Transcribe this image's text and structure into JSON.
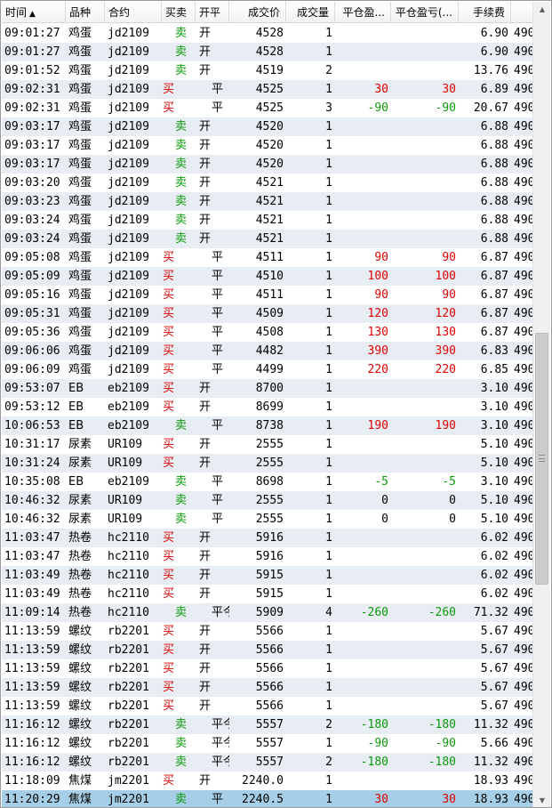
{
  "columns": {
    "time": "时间",
    "time_sort": "▲",
    "product": "品种",
    "contract": "合约",
    "side": "买卖",
    "open_close": "开平",
    "price": "成交价",
    "qty": "成交量",
    "close_pnl": "平仓盈...",
    "close_pnl2": "平仓盈亏(...",
    "fee": "手续费"
  },
  "rows": [
    {
      "time": "09:01:27",
      "product": "鸡蛋",
      "contract": "jd2109",
      "side": "卖",
      "oc": "开",
      "price": "4528",
      "qty": "1",
      "pnl1": "",
      "pnl2": "",
      "fee": "6.90",
      "ext": "490"
    },
    {
      "time": "09:01:27",
      "product": "鸡蛋",
      "contract": "jd2109",
      "side": "卖",
      "oc": "开",
      "price": "4528",
      "qty": "1",
      "pnl1": "",
      "pnl2": "",
      "fee": "6.90",
      "ext": "490"
    },
    {
      "time": "09:01:52",
      "product": "鸡蛋",
      "contract": "jd2109",
      "side": "卖",
      "oc": "开",
      "price": "4519",
      "qty": "2",
      "pnl1": "",
      "pnl2": "",
      "fee": "13.76",
      "ext": "490"
    },
    {
      "time": "09:02:31",
      "product": "鸡蛋",
      "contract": "jd2109",
      "side": "买",
      "oc": "平",
      "price": "4525",
      "qty": "1",
      "pnl1": "30",
      "pnl2": "30",
      "fee": "6.89",
      "ext": "490"
    },
    {
      "time": "09:02:31",
      "product": "鸡蛋",
      "contract": "jd2109",
      "side": "买",
      "oc": "平",
      "price": "4525",
      "qty": "3",
      "pnl1": "-90",
      "pnl2": "-90",
      "fee": "20.67",
      "ext": "490"
    },
    {
      "time": "09:03:17",
      "product": "鸡蛋",
      "contract": "jd2109",
      "side": "卖",
      "oc": "开",
      "price": "4520",
      "qty": "1",
      "pnl1": "",
      "pnl2": "",
      "fee": "6.88",
      "ext": "490"
    },
    {
      "time": "09:03:17",
      "product": "鸡蛋",
      "contract": "jd2109",
      "side": "卖",
      "oc": "开",
      "price": "4520",
      "qty": "1",
      "pnl1": "",
      "pnl2": "",
      "fee": "6.88",
      "ext": "490"
    },
    {
      "time": "09:03:17",
      "product": "鸡蛋",
      "contract": "jd2109",
      "side": "卖",
      "oc": "开",
      "price": "4520",
      "qty": "1",
      "pnl1": "",
      "pnl2": "",
      "fee": "6.88",
      "ext": "490"
    },
    {
      "time": "09:03:20",
      "product": "鸡蛋",
      "contract": "jd2109",
      "side": "卖",
      "oc": "开",
      "price": "4521",
      "qty": "1",
      "pnl1": "",
      "pnl2": "",
      "fee": "6.88",
      "ext": "490"
    },
    {
      "time": "09:03:23",
      "product": "鸡蛋",
      "contract": "jd2109",
      "side": "卖",
      "oc": "开",
      "price": "4521",
      "qty": "1",
      "pnl1": "",
      "pnl2": "",
      "fee": "6.88",
      "ext": "490"
    },
    {
      "time": "09:03:24",
      "product": "鸡蛋",
      "contract": "jd2109",
      "side": "卖",
      "oc": "开",
      "price": "4521",
      "qty": "1",
      "pnl1": "",
      "pnl2": "",
      "fee": "6.88",
      "ext": "490"
    },
    {
      "time": "09:03:24",
      "product": "鸡蛋",
      "contract": "jd2109",
      "side": "卖",
      "oc": "开",
      "price": "4521",
      "qty": "1",
      "pnl1": "",
      "pnl2": "",
      "fee": "6.88",
      "ext": "490"
    },
    {
      "time": "09:05:08",
      "product": "鸡蛋",
      "contract": "jd2109",
      "side": "买",
      "oc": "平",
      "price": "4511",
      "qty": "1",
      "pnl1": "90",
      "pnl2": "90",
      "fee": "6.87",
      "ext": "490"
    },
    {
      "time": "09:05:09",
      "product": "鸡蛋",
      "contract": "jd2109",
      "side": "买",
      "oc": "平",
      "price": "4510",
      "qty": "1",
      "pnl1": "100",
      "pnl2": "100",
      "fee": "6.87",
      "ext": "490"
    },
    {
      "time": "09:05:16",
      "product": "鸡蛋",
      "contract": "jd2109",
      "side": "买",
      "oc": "平",
      "price": "4511",
      "qty": "1",
      "pnl1": "90",
      "pnl2": "90",
      "fee": "6.87",
      "ext": "490"
    },
    {
      "time": "09:05:31",
      "product": "鸡蛋",
      "contract": "jd2109",
      "side": "买",
      "oc": "平",
      "price": "4509",
      "qty": "1",
      "pnl1": "120",
      "pnl2": "120",
      "fee": "6.87",
      "ext": "490"
    },
    {
      "time": "09:05:36",
      "product": "鸡蛋",
      "contract": "jd2109",
      "side": "买",
      "oc": "平",
      "price": "4508",
      "qty": "1",
      "pnl1": "130",
      "pnl2": "130",
      "fee": "6.87",
      "ext": "490"
    },
    {
      "time": "09:06:06",
      "product": "鸡蛋",
      "contract": "jd2109",
      "side": "买",
      "oc": "平",
      "price": "4482",
      "qty": "1",
      "pnl1": "390",
      "pnl2": "390",
      "fee": "6.83",
      "ext": "490"
    },
    {
      "time": "09:06:09",
      "product": "鸡蛋",
      "contract": "jd2109",
      "side": "买",
      "oc": "平",
      "price": "4499",
      "qty": "1",
      "pnl1": "220",
      "pnl2": "220",
      "fee": "6.85",
      "ext": "490"
    },
    {
      "time": "09:53:07",
      "product": "EB",
      "contract": "eb2109",
      "side": "买",
      "oc": "开",
      "price": "8700",
      "qty": "1",
      "pnl1": "",
      "pnl2": "",
      "fee": "3.10",
      "ext": "490"
    },
    {
      "time": "09:53:12",
      "product": "EB",
      "contract": "eb2109",
      "side": "买",
      "oc": "开",
      "price": "8699",
      "qty": "1",
      "pnl1": "",
      "pnl2": "",
      "fee": "3.10",
      "ext": "490"
    },
    {
      "time": "10:06:53",
      "product": "EB",
      "contract": "eb2109",
      "side": "卖",
      "oc": "平",
      "price": "8738",
      "qty": "1",
      "pnl1": "190",
      "pnl2": "190",
      "fee": "3.10",
      "ext": "490"
    },
    {
      "time": "10:31:17",
      "product": "尿素",
      "contract": "UR109",
      "side": "买",
      "oc": "开",
      "price": "2555",
      "qty": "1",
      "pnl1": "",
      "pnl2": "",
      "fee": "5.10",
      "ext": "490"
    },
    {
      "time": "10:31:24",
      "product": "尿素",
      "contract": "UR109",
      "side": "买",
      "oc": "开",
      "price": "2555",
      "qty": "1",
      "pnl1": "",
      "pnl2": "",
      "fee": "5.10",
      "ext": "490"
    },
    {
      "time": "10:35:08",
      "product": "EB",
      "contract": "eb2109",
      "side": "卖",
      "oc": "平",
      "price": "8698",
      "qty": "1",
      "pnl1": "-5",
      "pnl2": "-5",
      "fee": "3.10",
      "ext": "490"
    },
    {
      "time": "10:46:32",
      "product": "尿素",
      "contract": "UR109",
      "side": "卖",
      "oc": "平",
      "price": "2555",
      "qty": "1",
      "pnl1": "0",
      "pnl2": "0",
      "fee": "5.10",
      "ext": "490"
    },
    {
      "time": "10:46:32",
      "product": "尿素",
      "contract": "UR109",
      "side": "卖",
      "oc": "平",
      "price": "2555",
      "qty": "1",
      "pnl1": "0",
      "pnl2": "0",
      "fee": "5.10",
      "ext": "490"
    },
    {
      "time": "11:03:47",
      "product": "热卷",
      "contract": "hc2110",
      "side": "买",
      "oc": "开",
      "price": "5916",
      "qty": "1",
      "pnl1": "",
      "pnl2": "",
      "fee": "6.02",
      "ext": "490"
    },
    {
      "time": "11:03:47",
      "product": "热卷",
      "contract": "hc2110",
      "side": "买",
      "oc": "开",
      "price": "5916",
      "qty": "1",
      "pnl1": "",
      "pnl2": "",
      "fee": "6.02",
      "ext": "490"
    },
    {
      "time": "11:03:49",
      "product": "热卷",
      "contract": "hc2110",
      "side": "买",
      "oc": "开",
      "price": "5915",
      "qty": "1",
      "pnl1": "",
      "pnl2": "",
      "fee": "6.02",
      "ext": "490"
    },
    {
      "time": "11:03:49",
      "product": "热卷",
      "contract": "hc2110",
      "side": "买",
      "oc": "开",
      "price": "5915",
      "qty": "1",
      "pnl1": "",
      "pnl2": "",
      "fee": "6.02",
      "ext": "490"
    },
    {
      "time": "11:09:14",
      "product": "热卷",
      "contract": "hc2110",
      "side": "卖",
      "oc": "平今",
      "price": "5909",
      "qty": "4",
      "pnl1": "-260",
      "pnl2": "-260",
      "fee": "71.32",
      "ext": "490"
    },
    {
      "time": "11:13:59",
      "product": "螺纹",
      "contract": "rb2201",
      "side": "买",
      "oc": "开",
      "price": "5566",
      "qty": "1",
      "pnl1": "",
      "pnl2": "",
      "fee": "5.67",
      "ext": "490"
    },
    {
      "time": "11:13:59",
      "product": "螺纹",
      "contract": "rb2201",
      "side": "买",
      "oc": "开",
      "price": "5566",
      "qty": "1",
      "pnl1": "",
      "pnl2": "",
      "fee": "5.67",
      "ext": "490"
    },
    {
      "time": "11:13:59",
      "product": "螺纹",
      "contract": "rb2201",
      "side": "买",
      "oc": "开",
      "price": "5566",
      "qty": "1",
      "pnl1": "",
      "pnl2": "",
      "fee": "5.67",
      "ext": "490"
    },
    {
      "time": "11:13:59",
      "product": "螺纹",
      "contract": "rb2201",
      "side": "买",
      "oc": "开",
      "price": "5566",
      "qty": "1",
      "pnl1": "",
      "pnl2": "",
      "fee": "5.67",
      "ext": "490"
    },
    {
      "time": "11:13:59",
      "product": "螺纹",
      "contract": "rb2201",
      "side": "买",
      "oc": "开",
      "price": "5566",
      "qty": "1",
      "pnl1": "",
      "pnl2": "",
      "fee": "5.67",
      "ext": "490"
    },
    {
      "time": "11:16:12",
      "product": "螺纹",
      "contract": "rb2201",
      "side": "卖",
      "oc": "平今",
      "price": "5557",
      "qty": "2",
      "pnl1": "-180",
      "pnl2": "-180",
      "fee": "11.32",
      "ext": "490"
    },
    {
      "time": "11:16:12",
      "product": "螺纹",
      "contract": "rb2201",
      "side": "卖",
      "oc": "平今",
      "price": "5557",
      "qty": "1",
      "pnl1": "-90",
      "pnl2": "-90",
      "fee": "5.66",
      "ext": "490"
    },
    {
      "time": "11:16:12",
      "product": "螺纹",
      "contract": "rb2201",
      "side": "卖",
      "oc": "平今",
      "price": "5557",
      "qty": "2",
      "pnl1": "-180",
      "pnl2": "-180",
      "fee": "11.32",
      "ext": "490"
    },
    {
      "time": "11:18:09",
      "product": "焦煤",
      "contract": "jm2201",
      "side": "买",
      "oc": "开",
      "price": "2240.0",
      "qty": "1",
      "pnl1": "",
      "pnl2": "",
      "fee": "18.93",
      "ext": "490"
    },
    {
      "time": "11:20:29",
      "product": "焦煤",
      "contract": "jm2201",
      "side": "卖",
      "oc": "平",
      "price": "2240.5",
      "qty": "1",
      "pnl1": "30",
      "pnl2": "30",
      "fee": "18.93",
      "ext": "490"
    }
  ],
  "selected_row_index": 41,
  "colors": {
    "buy": "#e00000",
    "sell": "#0a9a0a",
    "profit": "#e00000",
    "loss": "#0a9a0a",
    "row_alt": "#e8edf3",
    "selected": "#a6cfe7"
  },
  "icons": {
    "sort": "sort-ascending-icon",
    "scroll_up": "scroll-up-arrow-icon",
    "scroll_down": "scroll-down-arrow-icon"
  }
}
